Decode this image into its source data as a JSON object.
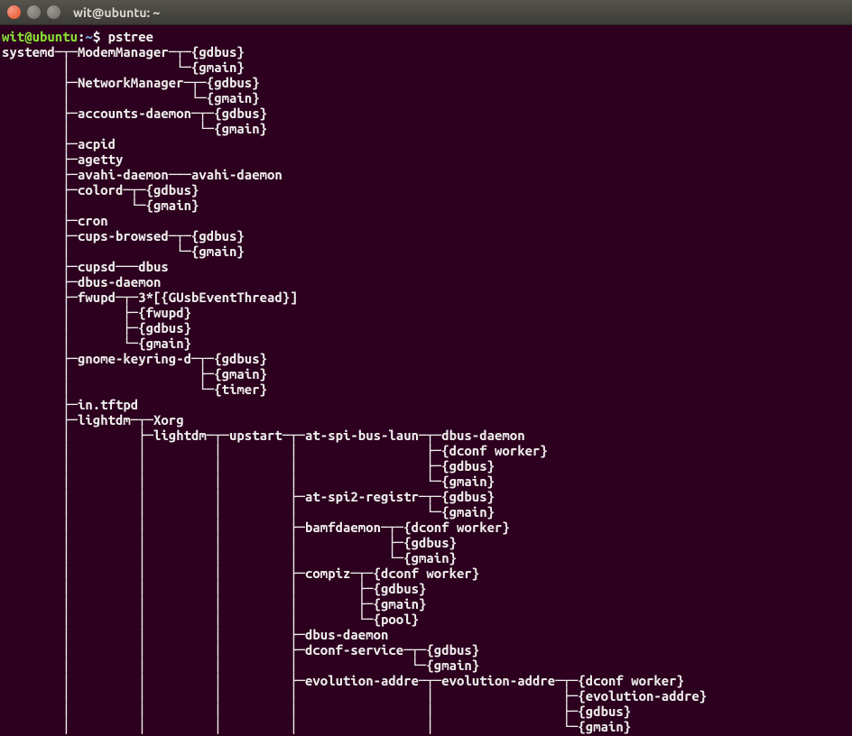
{
  "window": {
    "title": "wit@ubuntu: ~"
  },
  "prompt": {
    "userhost": "wit@ubuntu",
    "sep": ":",
    "path": "~",
    "sigil": "$ ",
    "command": "pstree"
  },
  "tree_lines": [
    "systemd─┬─ModemManager─┬─{gdbus}",
    "        │              └─{gmain}",
    "        ├─NetworkManager─┬─{gdbus}",
    "        │                └─{gmain}",
    "        ├─accounts-daemon─┬─{gdbus}",
    "        │                 └─{gmain}",
    "        ├─acpid",
    "        ├─agetty",
    "        ├─avahi-daemon───avahi-daemon",
    "        ├─colord─┬─{gdbus}",
    "        │        └─{gmain}",
    "        ├─cron",
    "        ├─cups-browsed─┬─{gdbus}",
    "        │              └─{gmain}",
    "        ├─cupsd───dbus",
    "        ├─dbus-daemon",
    "        ├─fwupd─┬─3*[{GUsbEventThread}]",
    "        │       ├─{fwupd}",
    "        │       ├─{gdbus}",
    "        │       └─{gmain}",
    "        ├─gnome-keyring-d─┬─{gdbus}",
    "        │                 ├─{gmain}",
    "        │                 └─{timer}",
    "        ├─in.tftpd",
    "        ├─lightdm─┬─Xorg",
    "        │         ├─lightdm─┬─upstart─┬─at-spi-bus-laun─┬─dbus-daemon",
    "        │         │         │         │                 ├─{dconf worker}",
    "        │         │         │         │                 ├─{gdbus}",
    "        │         │         │         │                 └─{gmain}",
    "        │         │         │         ├─at-spi2-registr─┬─{gdbus}",
    "        │         │         │         │                 └─{gmain}",
    "        │         │         │         ├─bamfdaemon─┬─{dconf worker}",
    "        │         │         │         │            ├─{gdbus}",
    "        │         │         │         │            └─{gmain}",
    "        │         │         │         ├─compiz─┬─{dconf worker}",
    "        │         │         │         │        ├─{gdbus}",
    "        │         │         │         │        ├─{gmain}",
    "        │         │         │         │        └─{pool}",
    "        │         │         │         ├─dbus-daemon",
    "        │         │         │         ├─dconf-service─┬─{gdbus}",
    "        │         │         │         │               └─{gmain}",
    "        │         │         │         ├─evolution-addre─┬─evolution-addre─┬─{dconf worker}",
    "        │         │         │         │                 │                 ├─{evolution-addre}",
    "        │         │         │         │                 │                 ├─{gdbus}",
    "        │         │         │         │                 │                 └─{gmain}"
  ]
}
